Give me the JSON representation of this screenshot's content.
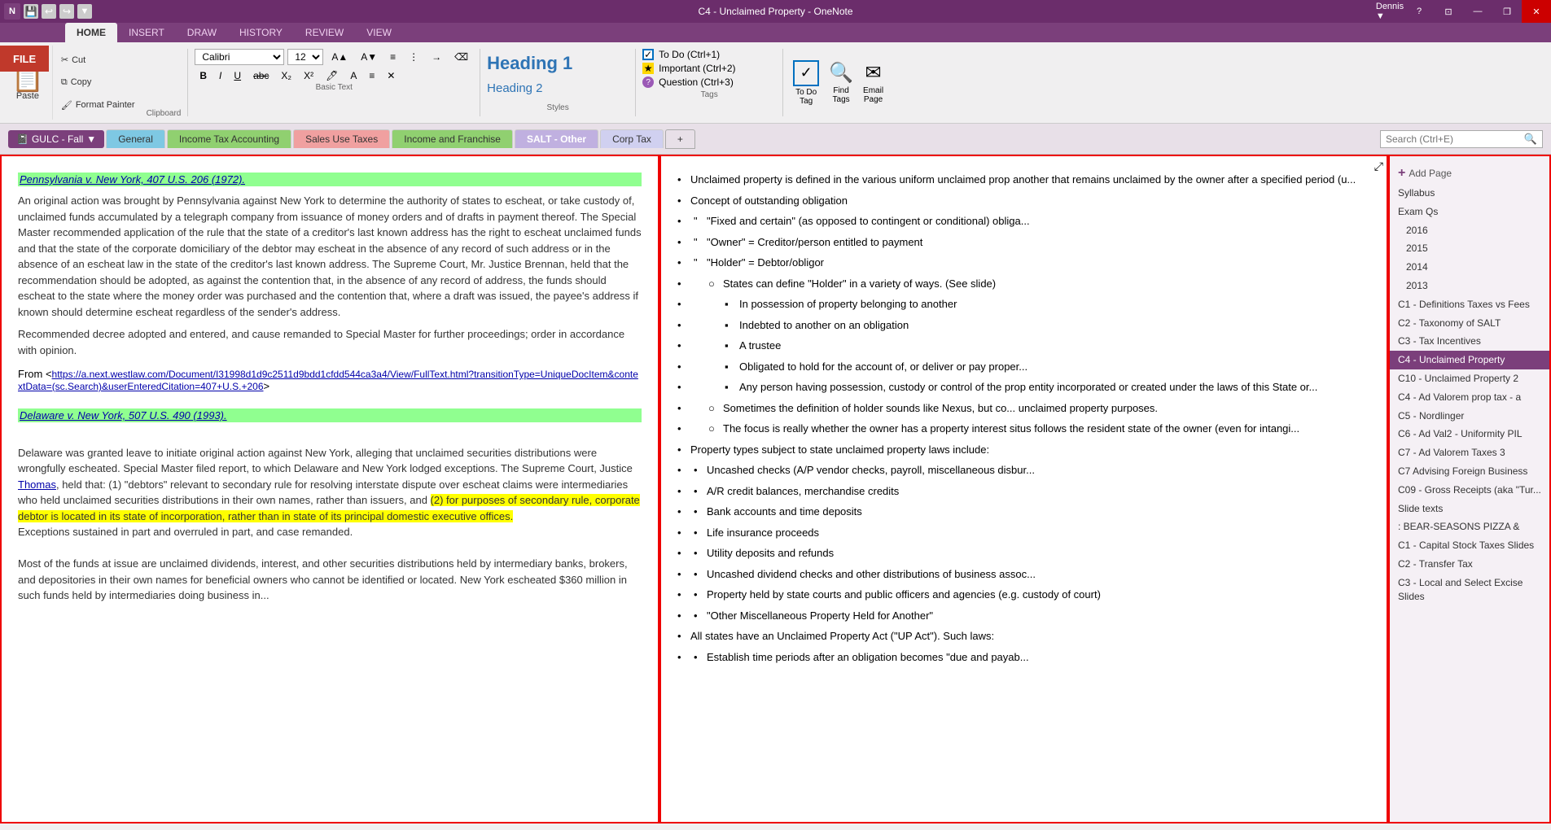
{
  "titleBar": {
    "title": "C4 - Unclaimed Property  -  OneNote",
    "controls": [
      "?",
      "—",
      "❐",
      "✕"
    ]
  },
  "ribbonTabs": [
    "FILE",
    "HOME",
    "INSERT",
    "DRAW",
    "HISTORY",
    "REVIEW",
    "VIEW"
  ],
  "activeRibbonTab": "HOME",
  "fileBtn": "FILE",
  "clipboard": {
    "pasteLabel": "Paste",
    "cutLabel": "Cut",
    "copyLabel": "Copy",
    "formatPainterLabel": "Format Painter"
  },
  "basicText": {
    "fontName": "Calibri",
    "fontSize": "12",
    "groupLabel": "Basic Text"
  },
  "styles": {
    "heading1": "Heading 1",
    "heading2": "Heading 2",
    "groupLabel": "Styles"
  },
  "tags": {
    "items": [
      "To Do (Ctrl+1)",
      "Important (Ctrl+2)",
      "Question (Ctrl+3)"
    ],
    "groupLabel": "Tags"
  },
  "toolbar": {
    "toDo": "To Do\nTag",
    "findTags": "Find\nTags",
    "emailPage": "Email\nPage"
  },
  "notebook": {
    "name": "GULC - Fall",
    "sections": [
      "General",
      "Income Tax Accounting",
      "Sales Use Taxes",
      "Income and Franchise",
      "SALT - Other",
      "Corp Tax",
      "+"
    ]
  },
  "search": {
    "placeholder": "Search (Ctrl+E)"
  },
  "leftContent": {
    "case1": {
      "citation": "Pennsylvania v. New York, 407 U.S. 206 (1972).",
      "text": "An original action was brought by Pennsylvania against New York to determine the authority of states to escheat, or take custody of, unclaimed funds accumulated by a telegraph company from issuance of money orders and of drafts in payment thereof. The Special Master recommended application of the rule that the state of a creditor's last known address has the right to escheat unclaimed funds and that the state of the corporate domiciliary of the debtor may escheat in the absence of any record of such address or in the absence of an escheat law in the state of the creditor's last known address. The Supreme Court, Mr. Justice Brennan, held that the recommendation should be adopted, as against the contention that, in the absence of any record of address, the funds should escheat to the state where the money order was purchased and the contention that, where a draft was issued, the payee's address if known should determine escheat regardless of the sender's address.\nRecommended decree adopted and entered, and cause remanded to Special Master for further proceedings; order in accordance with opinion.",
      "link": "https://a.next.westlaw.com/Document/I31998d1d9c2511d9bdd1cfdd544ca3a4/View/FullText.html?transitionType=UniqueDocItem&contextData=(sc.Search)&userEnteredCitation=407+U.S.+206"
    },
    "case2": {
      "citation": "Delaware v. New York, 507 U.S. 490 (1993).",
      "text": "Delaware was granted leave to initiate original action against New York, alleging that unclaimed securities distributions were wrongfully escheated. Special Master filed report, to which Delaware and New York lodged exceptions. The Supreme Court, Justice Thomas, held that: (1) \"debtors\" relevant to secondary rule for resolving interstate dispute over escheat claims were intermediaries who held unclaimed securities distributions in their own names, rather than issuers, and (2) for purposes of secondary rule, corporate debtor is located in its state of incorporation, rather than in state of its principal domestic executive offices.\nExceptions sustained in part and overruled in part, and case remanded.\n\nMost of the funds at issue are unclaimed dividends, interest, and other securities distributions held by intermediary banks, brokers, and depositories in their own names for beneficial owners who cannot be identified or located. New York escheated $360 million in such funds held by intermediaries doing business in..."
    }
  },
  "rightContent": {
    "bullets": [
      {
        "text": "Unclaimed property is defined in the various uniform unclaimed prop another that remains unclaimed by the owner after a specified period (u...",
        "level": 0
      },
      {
        "text": "Concept of outstanding obligation",
        "level": 0
      },
      {
        "text": "\"Fixed and certain\" (as opposed to contingent or conditional) obliga...",
        "level": 1
      },
      {
        "text": "\"Owner\" = Creditor/person entitled to payment",
        "level": 1
      },
      {
        "text": "\"Holder\" = Debtor/obligor",
        "level": 1
      },
      {
        "text": "States can define \"Holder\" in a variety of ways. (See slide)",
        "level": 2
      },
      {
        "text": "In possession of property belonging to another",
        "level": 3
      },
      {
        "text": "Indebted to another on an obligation",
        "level": 3
      },
      {
        "text": "A trustee",
        "level": 3
      },
      {
        "text": "Obligated to hold for the account of, or deliver or pay proper...",
        "level": 3
      },
      {
        "text": "Any person having possession, custody or control of the prop entity incorporated or created under the laws of this State or...",
        "level": 3
      },
      {
        "text": "Sometimes the definition of holder sounds like Nexus, but co... unclaimed property purposes.",
        "level": 2
      },
      {
        "text": "The focus is really whether the owner has a property interest situs follows the resident state of the owner (even for intangi...",
        "level": 2
      },
      {
        "text": "Property types subject to state unclaimed property laws include:",
        "level": 0
      },
      {
        "text": "Uncashed checks (A/P vendor checks, payroll, miscellaneous disbur...",
        "level": 1
      },
      {
        "text": "A/R credit balances, merchandise credits",
        "level": 1
      },
      {
        "text": "Bank accounts and time deposits",
        "level": 1
      },
      {
        "text": "Life insurance proceeds",
        "level": 1
      },
      {
        "text": "Utility deposits and refunds",
        "level": 1
      },
      {
        "text": "Uncashed dividend checks and other distributions of business assoc...",
        "level": 1
      },
      {
        "text": "Property held by state courts and public officers and agencies (e.g. custody of court)",
        "level": 1
      },
      {
        "text": "\"Other Miscellaneous Property Held for Another\"",
        "level": 1
      },
      {
        "text": "All states have an Unclaimed Property Act (\"UP Act\"). Such laws:",
        "level": 0
      },
      {
        "text": "Establish time periods after an obligation becomes \"due and payab...",
        "level": 1
      }
    ]
  },
  "sidebar": {
    "addPageLabel": "Add Page",
    "items": [
      {
        "label": "Syllabus",
        "active": false
      },
      {
        "label": "Exam Qs",
        "active": false
      },
      {
        "label": "2016",
        "active": false,
        "indent": true
      },
      {
        "label": "2015",
        "active": false,
        "indent": true
      },
      {
        "label": "2014",
        "active": false,
        "indent": true
      },
      {
        "label": "2013",
        "active": false,
        "indent": true
      },
      {
        "label": "C1 - Definitions Taxes vs Fees",
        "active": false
      },
      {
        "label": "C2 - Taxonomy of SALT",
        "active": false
      },
      {
        "label": "C3 - Tax Incentives",
        "active": false
      },
      {
        "label": "C4 - Unclaimed Property",
        "active": true
      },
      {
        "label": "C10 - Unclaimed Property 2",
        "active": false
      },
      {
        "label": "C4 - Ad Valorem prop tax - a",
        "active": false
      },
      {
        "label": "C5 - Nordlinger",
        "active": false
      },
      {
        "label": "C6 - Ad Val2 - Uniformity PIL",
        "active": false
      },
      {
        "label": "C7 - Ad Valorem Taxes 3",
        "active": false
      },
      {
        "label": "C7 Advising Foreign Business",
        "active": false
      },
      {
        "label": "C09 - Gross Receipts (aka \"Tur...",
        "active": false
      },
      {
        "label": "Slide texts",
        "active": false
      },
      {
        "label": ": BEAR-SEASONS PIZZA &",
        "active": false
      },
      {
        "label": "C1 - Capital Stock Taxes Slides",
        "active": false
      },
      {
        "label": "C2 - Transfer Tax",
        "active": false
      },
      {
        "label": "C3 - Local and Select Excise Slides",
        "active": false
      }
    ]
  },
  "colors": {
    "purple": "#7b3f7b",
    "red": "#e00000",
    "blue": "#2e74b5",
    "green": "#90d070",
    "lightBlue": "#7ec8e3",
    "pink": "#f0a0a0",
    "lavender": "#c0b0e0"
  }
}
